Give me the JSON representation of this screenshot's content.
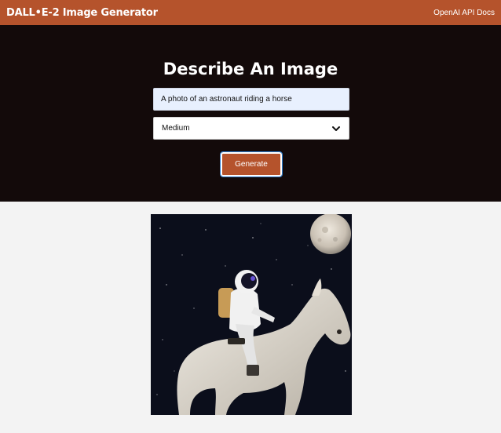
{
  "navbar": {
    "brand": "DALL•E-2 Image Generator",
    "link": "OpenAI API Docs"
  },
  "form": {
    "title": "Describe An Image",
    "prompt_value": "A photo of an astronaut riding a horse",
    "size_selected": "Medium",
    "generate_label": "Generate"
  },
  "result": {
    "alt": "Generated image"
  },
  "colors": {
    "accent": "#b5532c",
    "hero_bg": "#130a0a",
    "page_bg": "#f3f3f3"
  }
}
